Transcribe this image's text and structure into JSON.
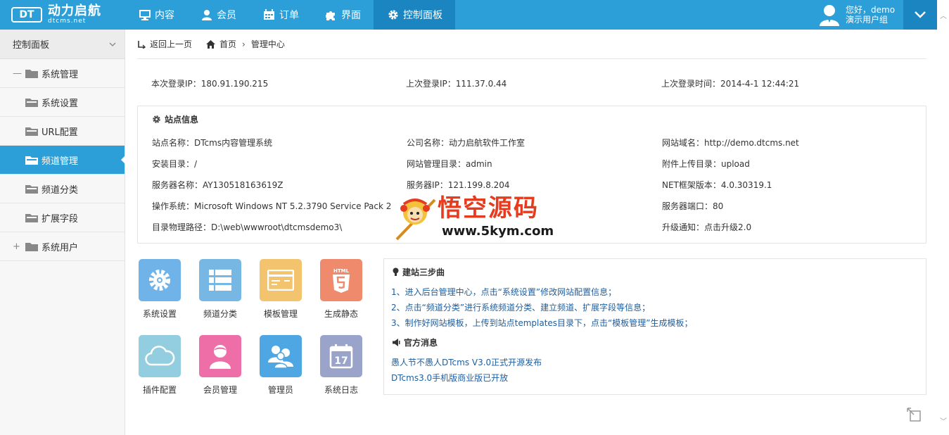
{
  "logo": {
    "badge": "DT",
    "name": "动力启航",
    "domain": "dtcms.net"
  },
  "nav": [
    {
      "label": "内容",
      "icon": "monitor-icon"
    },
    {
      "label": "会员",
      "icon": "user-icon"
    },
    {
      "label": "订单",
      "icon": "order-icon"
    },
    {
      "label": "界面",
      "icon": "puzzle-icon"
    },
    {
      "label": "控制面板",
      "icon": "gear-icon",
      "active": true
    }
  ],
  "user": {
    "greeting": "您好，demo",
    "group": "演示用户组"
  },
  "sidebar": {
    "title": "控制面板",
    "items": [
      {
        "label": "系统管理",
        "expander": "—"
      },
      {
        "label": "系统设置"
      },
      {
        "label": "URL配置"
      },
      {
        "label": "频道管理",
        "active": true
      },
      {
        "label": "频道分类"
      },
      {
        "label": "扩展字段"
      },
      {
        "label": "系统用户",
        "expander": "+"
      }
    ]
  },
  "breadcrumb": {
    "back": "返回上一页",
    "home": "首页",
    "current": "管理中心"
  },
  "login": {
    "this_ip": "本次登录IP：180.91.190.215",
    "last_ip": "上次登录IP：111.37.0.44",
    "last_time": "上次登录时间：2014-4-1 12:44:21"
  },
  "site_info": {
    "title": "站点信息",
    "cells": [
      "站点名称：DTcms内容管理系统",
      "公司名称：动力启航软件工作室",
      "网站域名：http://demo.dtcms.net",
      "安装目录：/",
      "网站管理目录：admin",
      "附件上传目录：upload",
      "服务器名称：AY130518163619Z",
      "服务器IP：121.199.8.204",
      "NET框架版本：4.0.30319.1",
      "操作系统：Microsoft Windows NT 5.2.3790 Service Pack 2",
      "",
      "服务器端口：80",
      "目录物理路径：D:\\web\\wwwroot\\dtcmsdemo3\\",
      "",
      "升级通知：点击升级2.0"
    ]
  },
  "apps": [
    {
      "label": "系统设置",
      "icon": "settings-icon",
      "color": "#6fb3e8"
    },
    {
      "label": "频道分类",
      "icon": "list-icon",
      "color": "#76b7e4"
    },
    {
      "label": "模板管理",
      "icon": "template-icon",
      "color": "#f3c36e"
    },
    {
      "label": "生成静态",
      "icon": "html5-icon",
      "color": "#ef8a6c"
    },
    {
      "label": "插件配置",
      "icon": "cloud-icon",
      "color": "#93cde0"
    },
    {
      "label": "会员管理",
      "icon": "member-icon",
      "color": "#ee6fa7"
    },
    {
      "label": "管理员",
      "icon": "admins-icon",
      "color": "#4ea7e3"
    },
    {
      "label": "系统日志",
      "icon": "calendar-icon",
      "color": "#9aa3c9"
    }
  ],
  "steps": {
    "title": "建站三步曲",
    "lines": [
      "1、进入后台管理中心，点击“系统设置”修改网站配置信息；",
      "2、点击“频道分类”进行系统频道分类、建立频道、扩展字段等信息；",
      "3、制作好网站模板，上传到站点templates目录下，点击“模板管理”生成模板；"
    ],
    "news_title": "官方消息",
    "news": [
      "愚人节不愚人DTcms V3.0正式开源发布",
      "DTcms3.0手机版商业版已开放"
    ]
  },
  "watermark": {
    "title": "悟空源码",
    "url": "www.5kym.com"
  },
  "colors": {
    "header": "#2d9fd8",
    "header_active": "#1b85c2",
    "link": "#1d5fa0"
  }
}
